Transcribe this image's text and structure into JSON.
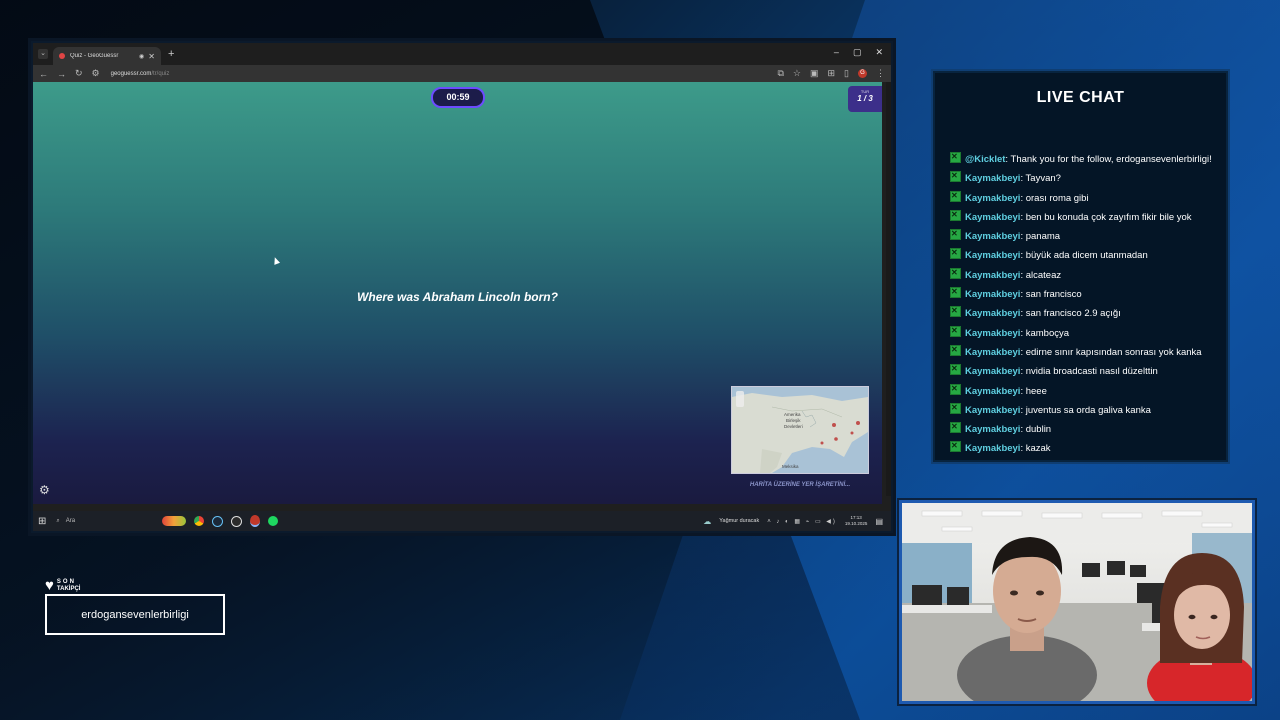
{
  "browser": {
    "tab_title": "Quiz - GeoGuessr",
    "new_tab": "+",
    "url_host": "geoguessr.com",
    "url_path": "/tr/quiz",
    "window_controls": [
      "–",
      "▢",
      "✕"
    ],
    "profile_initial": "G"
  },
  "game": {
    "timer": "00:59",
    "round_label": "TUR",
    "round_value": "1 / 3",
    "question": "Where was Abraham Lincoln born?",
    "map_labels": [
      "Amerika",
      "Birleşik",
      "Devletleri",
      "Meksika"
    ],
    "map_hint": "HARİTA ÜZERİNE YER İŞARETİNİ..."
  },
  "taskbar": {
    "search_placeholder": "Ara",
    "weather": "Yağmur duracak",
    "time": "17:13",
    "date": "19.10.2025"
  },
  "chat": {
    "title": "LIVE CHAT",
    "messages": [
      {
        "user": "@Kicklet",
        "text": ": Thank you for the follow, erdogansevenlerbirligi!"
      },
      {
        "user": "Kaymakbeyi",
        "text": ": Tayvan?"
      },
      {
        "user": "Kaymakbeyi",
        "text": ": orası roma gibi"
      },
      {
        "user": "Kaymakbeyi",
        "text": ": ben bu konuda çok zayıfım fikir bile yok"
      },
      {
        "user": "Kaymakbeyi",
        "text": ": panama"
      },
      {
        "user": "Kaymakbeyi",
        "text": ": büyük ada dicem utanmadan"
      },
      {
        "user": "Kaymakbeyi",
        "text": ": alcateaz"
      },
      {
        "user": "Kaymakbeyi",
        "text": ": san francisco"
      },
      {
        "user": "Kaymakbeyi",
        "text": ": san francisco 2.9 açığı"
      },
      {
        "user": "Kaymakbeyi",
        "text": ": kamboçya"
      },
      {
        "user": "Kaymakbeyi",
        "text": ": edirne sınır kapısından sonrası yok kanka"
      },
      {
        "user": "Kaymakbeyi",
        "text": ": nvidia broadcasti nasıl düzelttin"
      },
      {
        "user": "Kaymakbeyi",
        "text": ": heee"
      },
      {
        "user": "Kaymakbeyi",
        "text": ": juventus sa orda galiva kanka"
      },
      {
        "user": "Kaymakbeyi",
        "text": ": dublin"
      },
      {
        "user": "Kaymakbeyi",
        "text": ": kazak"
      }
    ]
  },
  "follower": {
    "label_top": "SON",
    "label_bottom": "TAKİPÇİ",
    "name": "erdogansevenlerbirligi"
  },
  "colors": {
    "chat_user": "#5fcfe0",
    "badge": "#26a843",
    "timer_border": "#6c4cff"
  }
}
